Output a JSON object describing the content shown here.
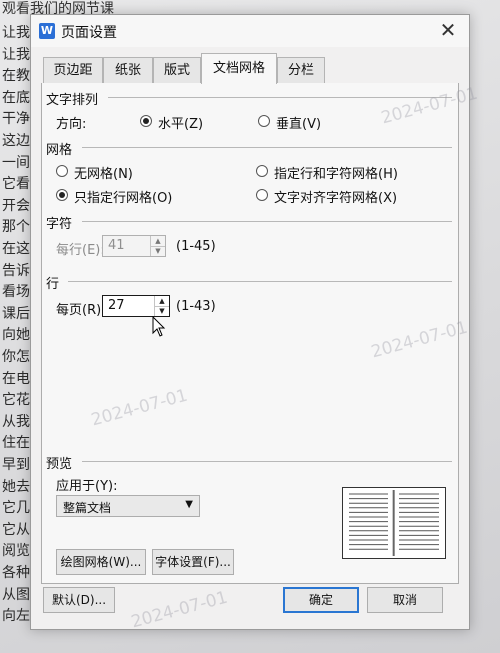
{
  "background": {
    "top_line": "观看我们的网节课",
    "lines": [
      "让我",
      "让我",
      "在教",
      "在底",
      "干净",
      "这边",
      "一间",
      "它看",
      "开会",
      "那个",
      "在这",
      "告诉",
      "看场",
      "课后",
      "向她",
      "你怎",
      "在电",
      "它花",
      "从我",
      "住在",
      "早到",
      "她去",
      "它几",
      "它从",
      "阅览",
      "各种",
      "从图",
      "向左"
    ]
  },
  "dialog": {
    "icon_glyph": "W",
    "title": "页面设置",
    "close_glyph": "✕",
    "tabs": [
      "页边距",
      "纸张",
      "版式",
      "文档网格",
      "分栏"
    ],
    "active_tab": "文档网格",
    "text_direction": {
      "section": "文字排列",
      "label": "方向:",
      "options": [
        "水平(Z)",
        "垂直(V)"
      ],
      "selected": "水平(Z)"
    },
    "grid": {
      "section": "网格",
      "options": [
        "无网格(N)",
        "指定行和字符网格(H)",
        "只指定行网格(O)",
        "文字对齐字符网格(X)"
      ],
      "selected": "只指定行网格(O)"
    },
    "characters": {
      "section": "字符",
      "label": "每行(E):",
      "value": "41",
      "range": "(1-45)",
      "enabled": false
    },
    "lines": {
      "section": "行",
      "label": "每页(R):",
      "value": "27",
      "range": "(1-43)",
      "enabled": true
    },
    "preview": {
      "section": "预览",
      "apply_label": "应用于(Y):",
      "apply_value": "整篇文档"
    },
    "buttons": {
      "draw_grid": "绘图网格(W)...",
      "font_settings": "字体设置(F)...",
      "default": "默认(D)...",
      "ok": "确定",
      "cancel": "取消"
    }
  },
  "watermarks": [
    "2024-07-01",
    "2024-07-01",
    "2024-07-01",
    "2024-07-01"
  ],
  "colors": {
    "dialog_bg": "#f1f0f0",
    "panel_bg": "#f7f7f7",
    "accent_border": "#2a76d2"
  }
}
